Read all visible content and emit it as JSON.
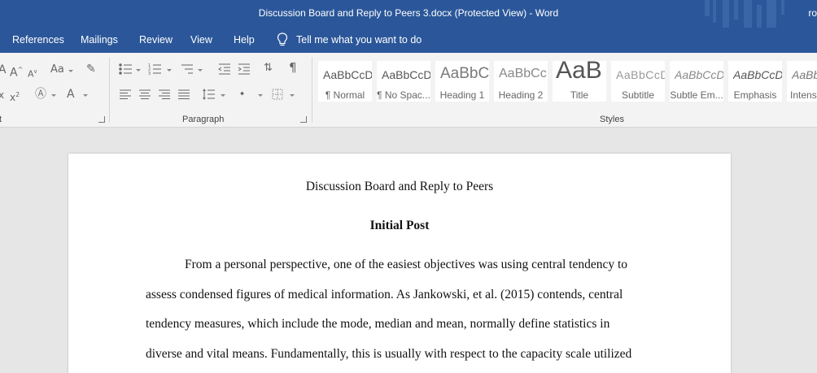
{
  "window": {
    "title": "Discussion Board and Reply to Peers 3.docx (Protected View)  -  Word",
    "user_initials": "ro"
  },
  "menu": {
    "tabs": [
      "References",
      "Mailings",
      "Review",
      "View",
      "Help"
    ],
    "tell_me": "Tell me what you want to do"
  },
  "ribbon": {
    "font_group_label": "t",
    "paragraph_group_label": "Paragraph",
    "styles_group_label": "Styles",
    "styles": [
      {
        "preview": "AaBbCcDc",
        "name": "¶ Normal"
      },
      {
        "preview": "AaBbCcDc",
        "name": "¶ No Spac..."
      },
      {
        "preview": "AaBbCc",
        "name": "Heading 1"
      },
      {
        "preview": "AaBbCcD",
        "name": "Heading 2"
      },
      {
        "preview": "AaB",
        "name": "Title"
      },
      {
        "preview": "AaBbCcD",
        "name": "Subtitle"
      },
      {
        "preview": "AaBbCcDc",
        "name": "Subtle Em..."
      },
      {
        "preview": "AaBbCcDc",
        "name": "Emphasis"
      },
      {
        "preview": "AaBbCcDc",
        "name": "Intens"
      }
    ]
  },
  "document": {
    "heading": "Discussion Board and Reply to Peers",
    "subheading": "Initial Post",
    "lines": [
      "From a personal perspective, one of the easiest objectives was using central tendency to",
      "assess condensed figures of medical information. As Jankowski, et al. (2015) contends, central",
      "tendency measures, which include the mode, median and mean, normally define statistics in",
      "diverse and vital means. Fundamentally, this is usually with respect to the capacity scale utilized"
    ]
  }
}
